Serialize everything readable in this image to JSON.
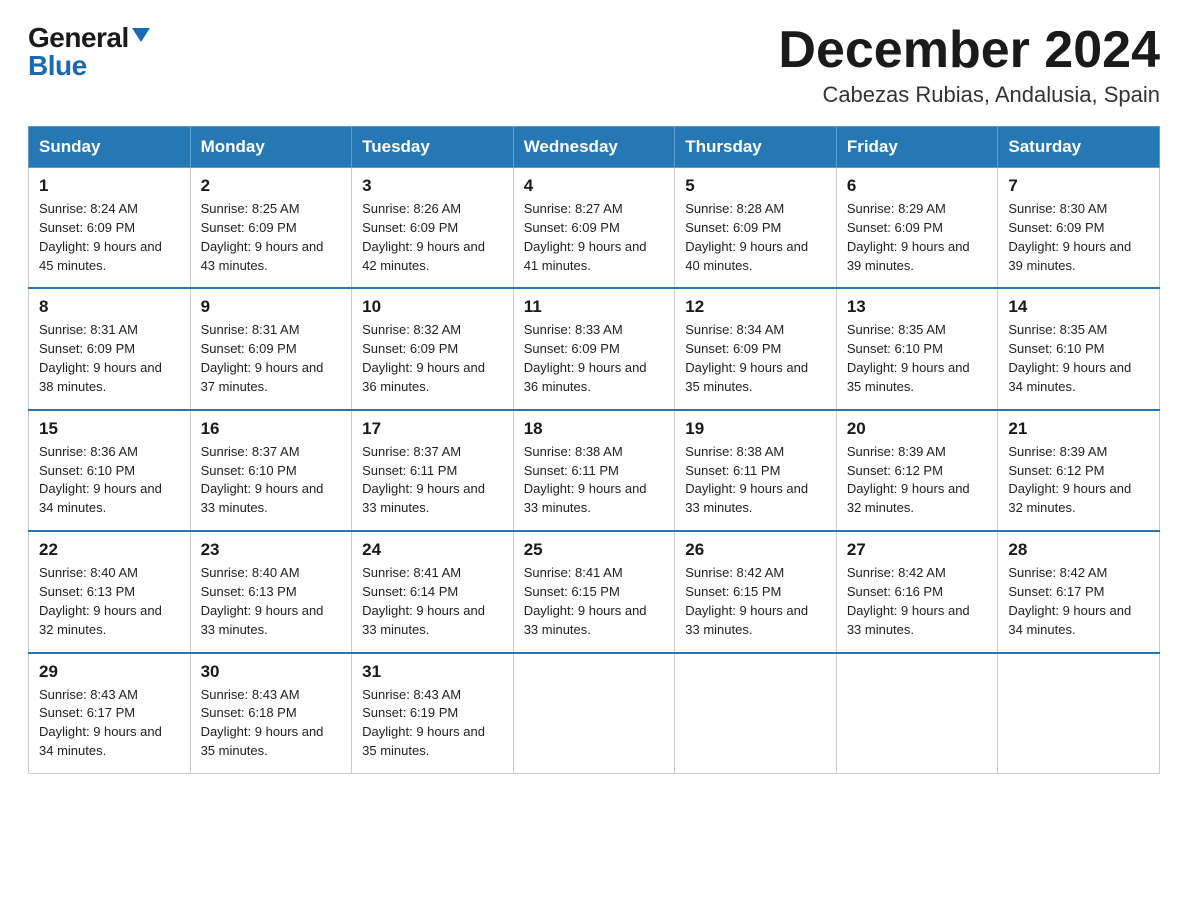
{
  "header": {
    "logo_general": "General",
    "logo_blue": "Blue",
    "month_title": "December 2024",
    "location": "Cabezas Rubias, Andalusia, Spain"
  },
  "days_of_week": [
    "Sunday",
    "Monday",
    "Tuesday",
    "Wednesday",
    "Thursday",
    "Friday",
    "Saturday"
  ],
  "weeks": [
    [
      {
        "day": "1",
        "sunrise": "8:24 AM",
        "sunset": "6:09 PM",
        "daylight": "9 hours and 45 minutes."
      },
      {
        "day": "2",
        "sunrise": "8:25 AM",
        "sunset": "6:09 PM",
        "daylight": "9 hours and 43 minutes."
      },
      {
        "day": "3",
        "sunrise": "8:26 AM",
        "sunset": "6:09 PM",
        "daylight": "9 hours and 42 minutes."
      },
      {
        "day": "4",
        "sunrise": "8:27 AM",
        "sunset": "6:09 PM",
        "daylight": "9 hours and 41 minutes."
      },
      {
        "day": "5",
        "sunrise": "8:28 AM",
        "sunset": "6:09 PM",
        "daylight": "9 hours and 40 minutes."
      },
      {
        "day": "6",
        "sunrise": "8:29 AM",
        "sunset": "6:09 PM",
        "daylight": "9 hours and 39 minutes."
      },
      {
        "day": "7",
        "sunrise": "8:30 AM",
        "sunset": "6:09 PM",
        "daylight": "9 hours and 39 minutes."
      }
    ],
    [
      {
        "day": "8",
        "sunrise": "8:31 AM",
        "sunset": "6:09 PM",
        "daylight": "9 hours and 38 minutes."
      },
      {
        "day": "9",
        "sunrise": "8:31 AM",
        "sunset": "6:09 PM",
        "daylight": "9 hours and 37 minutes."
      },
      {
        "day": "10",
        "sunrise": "8:32 AM",
        "sunset": "6:09 PM",
        "daylight": "9 hours and 36 minutes."
      },
      {
        "day": "11",
        "sunrise": "8:33 AM",
        "sunset": "6:09 PM",
        "daylight": "9 hours and 36 minutes."
      },
      {
        "day": "12",
        "sunrise": "8:34 AM",
        "sunset": "6:09 PM",
        "daylight": "9 hours and 35 minutes."
      },
      {
        "day": "13",
        "sunrise": "8:35 AM",
        "sunset": "6:10 PM",
        "daylight": "9 hours and 35 minutes."
      },
      {
        "day": "14",
        "sunrise": "8:35 AM",
        "sunset": "6:10 PM",
        "daylight": "9 hours and 34 minutes."
      }
    ],
    [
      {
        "day": "15",
        "sunrise": "8:36 AM",
        "sunset": "6:10 PM",
        "daylight": "9 hours and 34 minutes."
      },
      {
        "day": "16",
        "sunrise": "8:37 AM",
        "sunset": "6:10 PM",
        "daylight": "9 hours and 33 minutes."
      },
      {
        "day": "17",
        "sunrise": "8:37 AM",
        "sunset": "6:11 PM",
        "daylight": "9 hours and 33 minutes."
      },
      {
        "day": "18",
        "sunrise": "8:38 AM",
        "sunset": "6:11 PM",
        "daylight": "9 hours and 33 minutes."
      },
      {
        "day": "19",
        "sunrise": "8:38 AM",
        "sunset": "6:11 PM",
        "daylight": "9 hours and 33 minutes."
      },
      {
        "day": "20",
        "sunrise": "8:39 AM",
        "sunset": "6:12 PM",
        "daylight": "9 hours and 32 minutes."
      },
      {
        "day": "21",
        "sunrise": "8:39 AM",
        "sunset": "6:12 PM",
        "daylight": "9 hours and 32 minutes."
      }
    ],
    [
      {
        "day": "22",
        "sunrise": "8:40 AM",
        "sunset": "6:13 PM",
        "daylight": "9 hours and 32 minutes."
      },
      {
        "day": "23",
        "sunrise": "8:40 AM",
        "sunset": "6:13 PM",
        "daylight": "9 hours and 33 minutes."
      },
      {
        "day": "24",
        "sunrise": "8:41 AM",
        "sunset": "6:14 PM",
        "daylight": "9 hours and 33 minutes."
      },
      {
        "day": "25",
        "sunrise": "8:41 AM",
        "sunset": "6:15 PM",
        "daylight": "9 hours and 33 minutes."
      },
      {
        "day": "26",
        "sunrise": "8:42 AM",
        "sunset": "6:15 PM",
        "daylight": "9 hours and 33 minutes."
      },
      {
        "day": "27",
        "sunrise": "8:42 AM",
        "sunset": "6:16 PM",
        "daylight": "9 hours and 33 minutes."
      },
      {
        "day": "28",
        "sunrise": "8:42 AM",
        "sunset": "6:17 PM",
        "daylight": "9 hours and 34 minutes."
      }
    ],
    [
      {
        "day": "29",
        "sunrise": "8:43 AM",
        "sunset": "6:17 PM",
        "daylight": "9 hours and 34 minutes."
      },
      {
        "day": "30",
        "sunrise": "8:43 AM",
        "sunset": "6:18 PM",
        "daylight": "9 hours and 35 minutes."
      },
      {
        "day": "31",
        "sunrise": "8:43 AM",
        "sunset": "6:19 PM",
        "daylight": "9 hours and 35 minutes."
      },
      null,
      null,
      null,
      null
    ]
  ],
  "sunrise_label": "Sunrise:",
  "sunset_label": "Sunset:",
  "daylight_label": "Daylight:"
}
